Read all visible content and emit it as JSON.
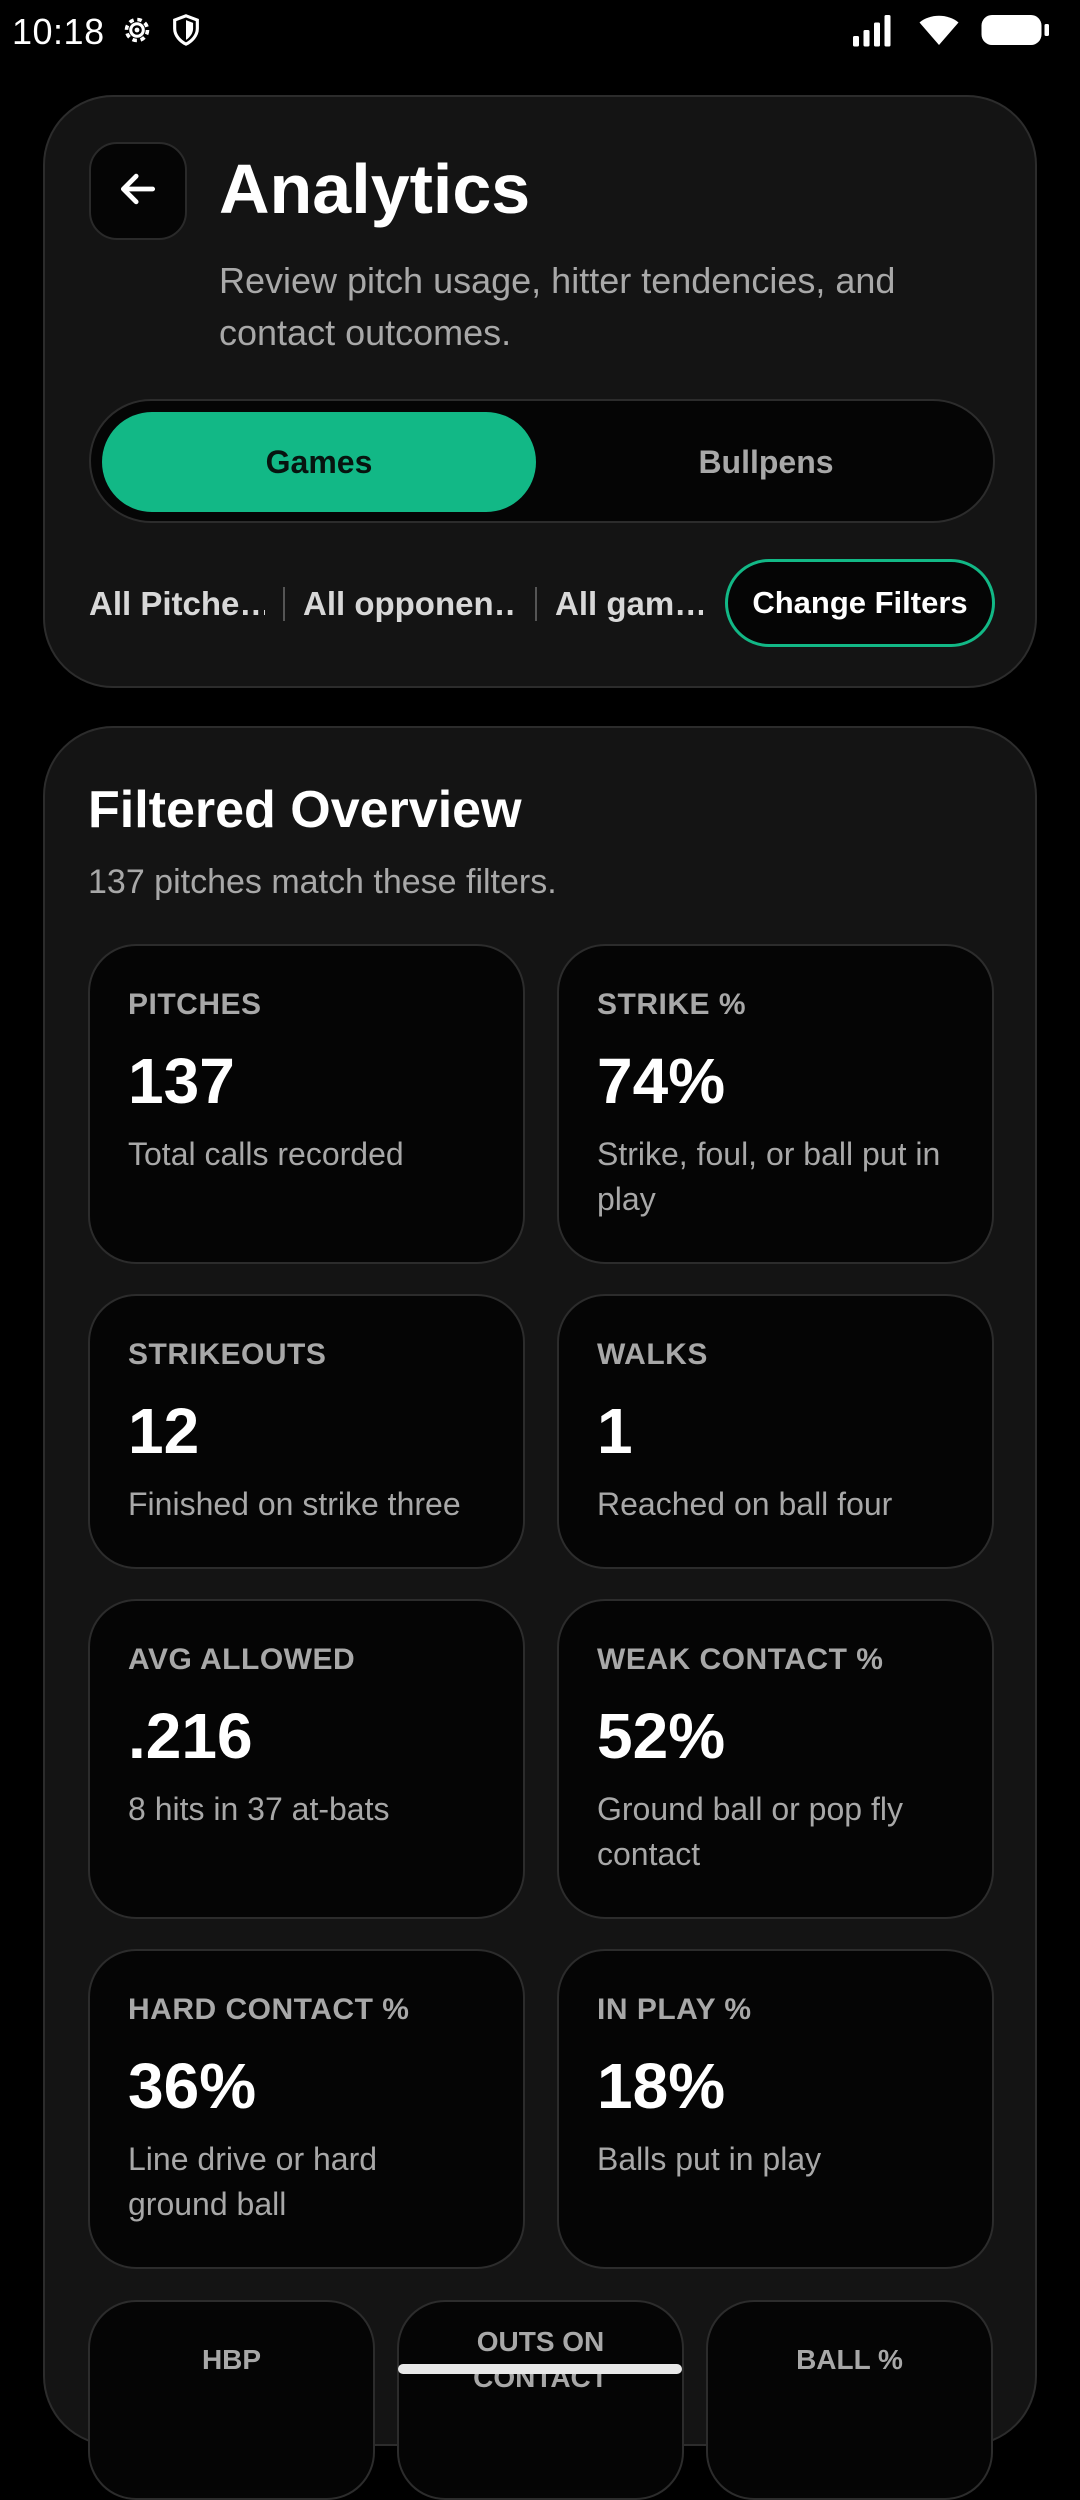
{
  "status_bar": {
    "time": "10:18",
    "icons": [
      "settings-icon",
      "shield-icon",
      "signal-icon",
      "wifi-icon",
      "battery-icon"
    ]
  },
  "header": {
    "title": "Analytics",
    "subtitle": "Review pitch usage, hitter tendencies, and contact outcomes.",
    "back_icon": "arrow-left-icon"
  },
  "segmented": {
    "options": [
      "Games",
      "Bullpens"
    ],
    "selected": "Games"
  },
  "filters": {
    "chips": [
      "All Pitche…",
      "All opponen…",
      "All gam…"
    ],
    "change_label": "Change Filters"
  },
  "overview": {
    "title": "Filtered Overview",
    "subtitle": "137 pitches match these filters.",
    "stats": [
      {
        "label": "PITCHES",
        "value": "137",
        "desc": "Total calls recorded"
      },
      {
        "label": "STRIKE %",
        "value": "74%",
        "desc": "Strike, foul, or ball put in play"
      },
      {
        "label": "STRIKEOUTS",
        "value": "12",
        "desc": "Finished on strike three"
      },
      {
        "label": "WALKS",
        "value": "1",
        "desc": "Reached on ball four"
      },
      {
        "label": "AVG ALLOWED",
        "value": ".216",
        "desc": "8 hits in 37 at-bats"
      },
      {
        "label": "WEAK CONTACT %",
        "value": "52%",
        "desc": "Ground ball or pop fly contact"
      },
      {
        "label": "HARD CONTACT %",
        "value": "36%",
        "desc": "Line drive or hard ground ball"
      },
      {
        "label": "IN PLAY %",
        "value": "18%",
        "desc": "Balls put in play"
      }
    ],
    "mini_stats": [
      {
        "label": "HBP"
      },
      {
        "label": "OUTS ON CONTACT"
      },
      {
        "label": "BALL %"
      }
    ]
  },
  "colors": {
    "accent": "#12b886",
    "background": "#000000",
    "card": "#141414",
    "inner_card": "#050505",
    "muted_text": "#a8a8a8"
  }
}
